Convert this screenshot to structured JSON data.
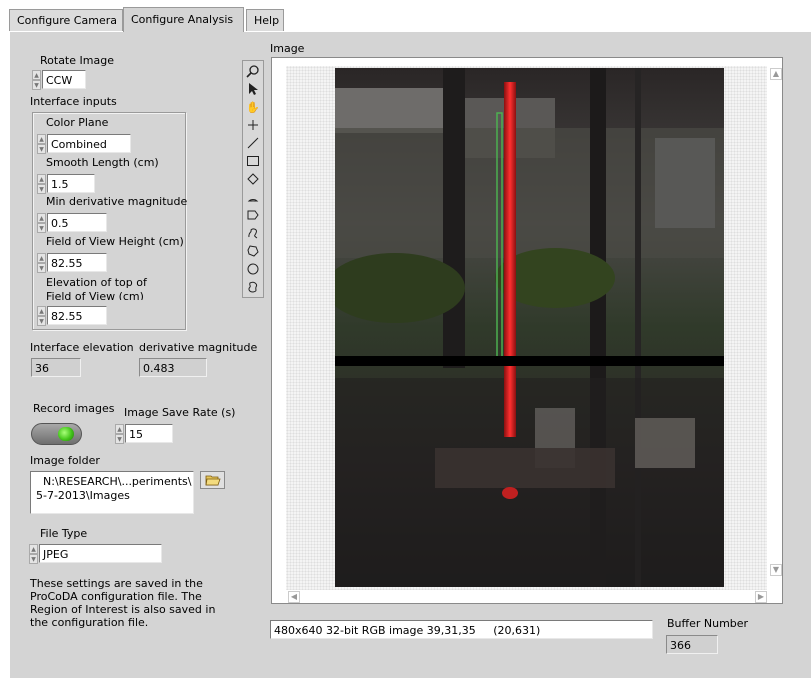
{
  "tabs": [
    {
      "label": "Configure Camera"
    },
    {
      "label": "Configure Analysis"
    },
    {
      "label": "Help"
    }
  ],
  "rotate": {
    "label": "Rotate Image",
    "value": "CCW"
  },
  "interface_inputs": {
    "title": "Interface inputs",
    "color_plane": {
      "label": "Color Plane",
      "value": "Combined"
    },
    "smooth_length": {
      "label": "Smooth Length (cm)",
      "value": "1.5"
    },
    "min_derivative": {
      "label": "Min derivative magnitude",
      "value": "0.5"
    },
    "fov_height": {
      "label": "Field of View Height (cm)",
      "value": "82.55"
    },
    "elevation_top": {
      "label_line1": "Elevation of top of",
      "label_line2": "Field of View (cm)",
      "value": "82.55"
    }
  },
  "interface_elevation": {
    "label": "Interface elevation",
    "value": "36"
  },
  "derivative_magnitude": {
    "label": "derivative magnitude",
    "value": "0.483"
  },
  "record_images": {
    "label": "Record images",
    "state": "on",
    "led_color": "#43c51a"
  },
  "image_save_rate": {
    "label": "Image Save Rate (s)",
    "value": "15"
  },
  "image_folder": {
    "label": "Image folder",
    "line1": "N:\\RESEARCH\\...periments\\",
    "line2": "5-7-2013\\Images"
  },
  "file_type": {
    "label": "File Type",
    "value": "JPEG"
  },
  "note": {
    "lines": [
      "These settings are saved in the",
      "ProCoDA configuration file. The",
      "Region of Interest is also saved in",
      "the configuration file."
    ]
  },
  "image": {
    "label": "Image",
    "status": "480x640 32-bit RGB image 39,31,35     (20,631)",
    "roi_color": "#4caf50",
    "tube_color": "#e02020",
    "line_color": "#000000"
  },
  "buffer_number": {
    "label": "Buffer Number",
    "value": "366"
  },
  "tools": [
    {
      "icon": "zoom-icon"
    },
    {
      "icon": "pointer-icon"
    },
    {
      "icon": "pan-hand-icon"
    },
    {
      "icon": "crosshair-icon"
    },
    {
      "icon": "line-tool-icon"
    },
    {
      "icon": "rectangle-tool-icon"
    },
    {
      "icon": "rotated-rect-icon"
    },
    {
      "icon": "annulus-tool-icon"
    },
    {
      "icon": "broken-line-icon"
    },
    {
      "icon": "freehand-line-icon"
    },
    {
      "icon": "polygon-tool-icon"
    },
    {
      "icon": "oval-tool-icon"
    },
    {
      "icon": "freehand-region-icon"
    }
  ]
}
